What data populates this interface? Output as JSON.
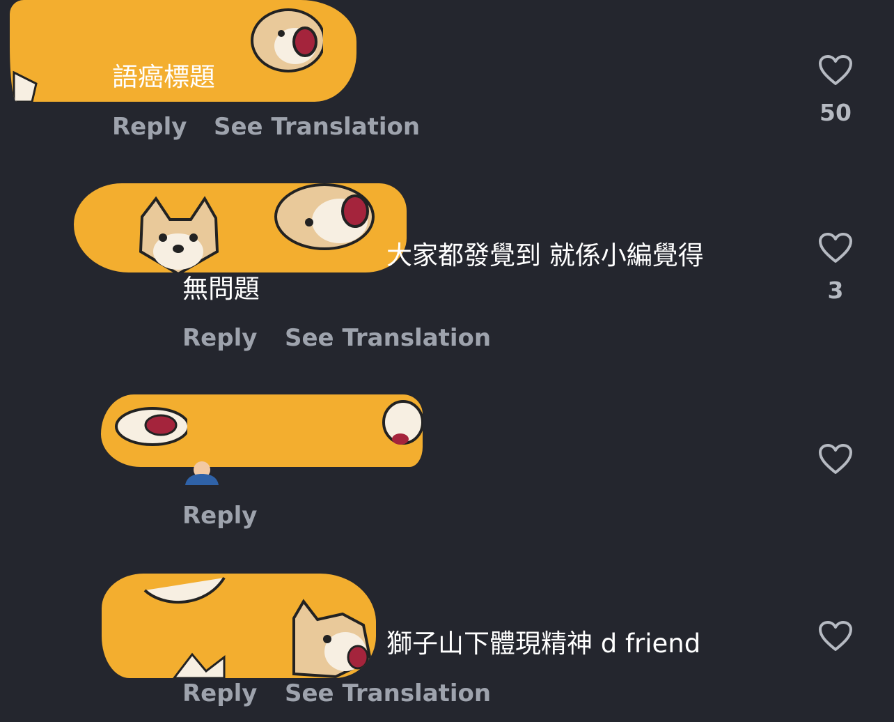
{
  "comments": [
    {
      "text": "語癌標題",
      "reply": "Reply",
      "see_translation": "See Translation",
      "likes": "50"
    },
    {
      "text_line1": "大家都發覺到 就係小編覺得",
      "text_line2": "無問題",
      "reply": "Reply",
      "see_translation": "See Translation",
      "likes": "3"
    },
    {
      "reply": "Reply",
      "likes": ""
    },
    {
      "text": "獅子山下體現精神 d friend",
      "reply": "Reply",
      "see_translation": "See Translation",
      "likes": ""
    }
  ],
  "colors": {
    "background": "#24262e",
    "primary_text": "#ffffff",
    "secondary_text": "#9ea3ad",
    "redaction_orange": "#f3ae2f"
  },
  "icons": [
    "heart-outline-icon",
    "shiba-sticker",
    "person-avatar-icon"
  ]
}
